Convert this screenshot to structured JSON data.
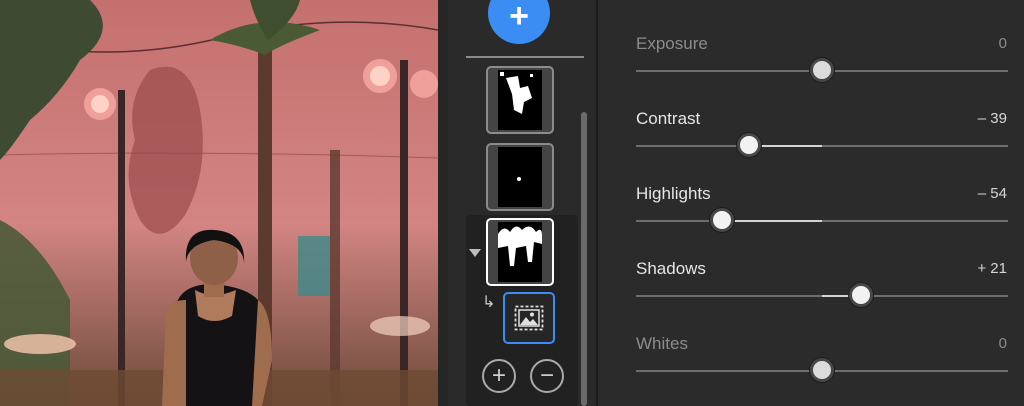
{
  "masks_panel": {
    "add_label": "+",
    "add_sub_label": "+",
    "subtract_label": "−"
  },
  "adjustments": [
    {
      "label": "Exposure",
      "value": "0",
      "amount": 0,
      "dimmed": true
    },
    {
      "label": "Contrast",
      "value": "– 39",
      "amount": -39,
      "dimmed": false
    },
    {
      "label": "Highlights",
      "value": "– 54",
      "amount": -54,
      "dimmed": false
    },
    {
      "label": "Shadows",
      "value": "+ 21",
      "amount": 21,
      "dimmed": false
    },
    {
      "label": "Whites",
      "value": "0",
      "amount": 0,
      "dimmed": true
    }
  ],
  "colors": {
    "accent": "#3b8cf3",
    "photo_overlay": "#e06868"
  }
}
